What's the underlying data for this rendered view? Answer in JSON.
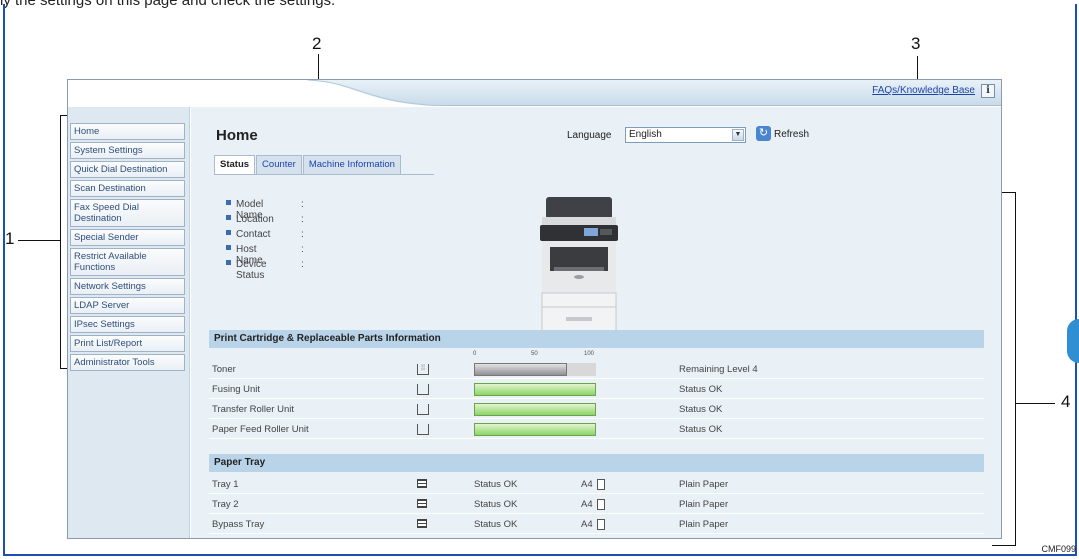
{
  "caption": {
    "text": "ly the settings on this page and check the settings."
  },
  "callouts": {
    "c1": "1",
    "c2": "2",
    "c3": "3",
    "c4": "4"
  },
  "figure_code": "CMF099",
  "header": {
    "faq_link": "FAQs/Knowledge Base",
    "info_icon": "i"
  },
  "sidebar": {
    "items": [
      {
        "label": "Home"
      },
      {
        "label": "System Settings"
      },
      {
        "label": "Quick Dial Destination"
      },
      {
        "label": "Scan Destination"
      },
      {
        "label": "Fax Speed Dial Destination"
      },
      {
        "label": "Special Sender"
      },
      {
        "label": "Restrict Available Functions"
      },
      {
        "label": "Network Settings"
      },
      {
        "label": "LDAP Server"
      },
      {
        "label": "IPsec Settings"
      },
      {
        "label": "Print List/Report"
      },
      {
        "label": "Administrator Tools"
      }
    ]
  },
  "main": {
    "title": "Home",
    "language_label": "Language",
    "language_value": "English",
    "refresh_label": "Refresh",
    "tabs": [
      {
        "label": "Status"
      },
      {
        "label": "Counter"
      },
      {
        "label": "Machine Information"
      }
    ],
    "device_info": [
      {
        "label": "Model Name",
        "colon": ":"
      },
      {
        "label": "Location",
        "colon": ":"
      },
      {
        "label": "Contact",
        "colon": ":"
      },
      {
        "label": "Host Name",
        "colon": ":"
      },
      {
        "label": "Device Status",
        "colon": ":"
      }
    ],
    "cartridge_section": {
      "title": "Print Cartridge & Replaceable Parts Information",
      "scale": [
        "0",
        "50",
        "100"
      ],
      "rows": [
        {
          "name": "Toner",
          "level_percent": 76,
          "status": "Remaining Level 4",
          "bar_color": "#9a9aa0"
        },
        {
          "name": "Fusing Unit",
          "level_percent": 100,
          "status": "Status OK",
          "bar_color": "#8dd36a"
        },
        {
          "name": "Transfer Roller Unit",
          "level_percent": 100,
          "status": "Status OK",
          "bar_color": "#8dd36a"
        },
        {
          "name": "Paper Feed Roller Unit",
          "level_percent": 100,
          "status": "Status OK",
          "bar_color": "#8dd36a"
        }
      ]
    },
    "paper_tray_section": {
      "title": "Paper Tray",
      "rows": [
        {
          "name": "Tray 1",
          "status": "Status OK",
          "size": "A4",
          "type": "Plain Paper"
        },
        {
          "name": "Tray 2",
          "status": "Status OK",
          "size": "A4",
          "type": "Plain Paper"
        },
        {
          "name": "Bypass Tray",
          "status": "Status OK",
          "size": "A4",
          "type": "Plain Paper"
        }
      ]
    }
  },
  "colors": {
    "frame": "#1d4fb0",
    "sidebar_bg": "#dde8f1",
    "main_bg": "#e9f0f6",
    "section_head": "#b9d3e9",
    "link": "#1d45a8"
  }
}
